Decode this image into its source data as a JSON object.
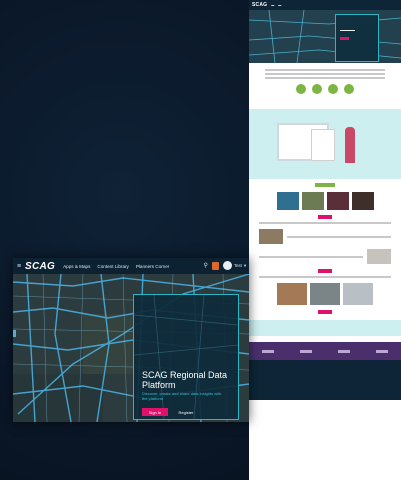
{
  "app": {
    "logo": "SCAG",
    "nav": [
      "Apps & Maps",
      "Content Library",
      "Planners Corner"
    ],
    "account_label": "Test",
    "hero": {
      "title": "SCAG Regional Data Platform",
      "tagline": "Discover, create and share data insights with the platform",
      "signin_label": "Sign In",
      "register_label": "Register"
    }
  },
  "colors": {
    "accent_teal": "#2bb6c6",
    "brand_pink": "#e0116b",
    "nav_bg": "#0c2233",
    "green": "#7db544"
  },
  "icons": {
    "menu": "hamburger-icon",
    "search": "search-icon",
    "notification": "orange-badge-icon",
    "account": "avatar"
  },
  "preview": {
    "logo": "SCAG"
  }
}
